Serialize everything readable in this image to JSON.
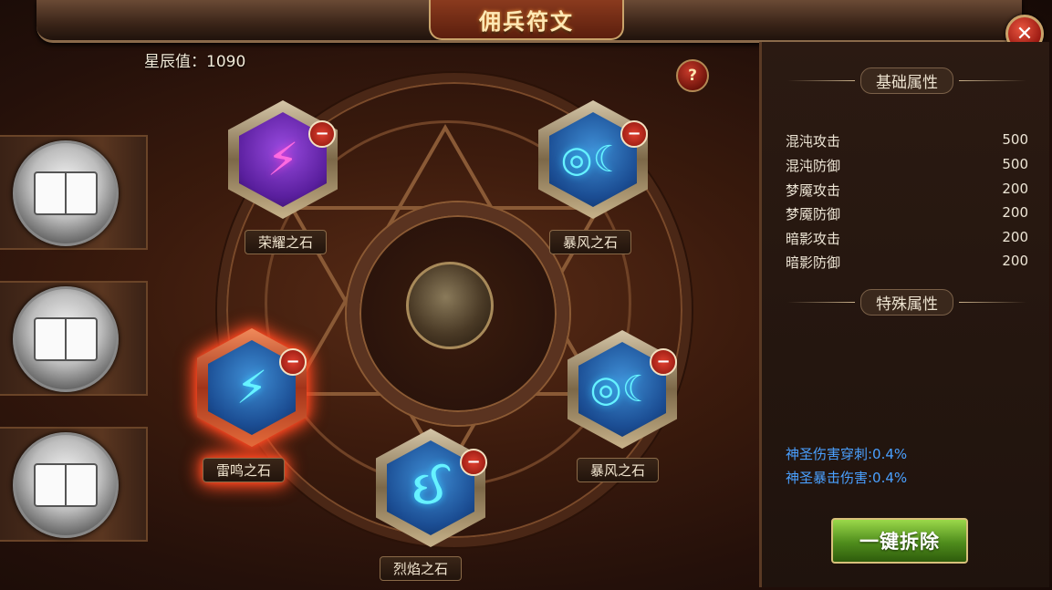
{
  "window": {
    "title": "佣兵符文"
  },
  "header": {
    "star_value_label": "星辰值：1090",
    "help_label": "?",
    "close_label": "✕"
  },
  "tabs": [
    {
      "icon": "book-icon"
    },
    {
      "icon": "book-icon"
    },
    {
      "icon": "book-icon"
    }
  ],
  "slots": {
    "glory": {
      "label": "荣耀之石",
      "glyph": "⚡",
      "gem_color": "#6a2fb3"
    },
    "storm1": {
      "label": "暴风之石",
      "glyph": "◎☾",
      "gem_color": "#1f5aa5"
    },
    "thunder": {
      "label": "雷鸣之石",
      "glyph": "⚡",
      "gem_color": "#1f5aa5"
    },
    "storm2": {
      "label": "暴风之石",
      "glyph": "◎☾",
      "gem_color": "#1f5aa5"
    },
    "flame": {
      "label": "烈焰之石",
      "glyph": "ઈ",
      "gem_color": "#1f5aa5"
    }
  },
  "remove_label": "−",
  "panel": {
    "base_header": "基础属性",
    "base_attrs": [
      {
        "name": "混沌攻击",
        "value": "500"
      },
      {
        "name": "混沌防御",
        "value": "500"
      },
      {
        "name": "梦魇攻击",
        "value": "200"
      },
      {
        "name": "梦魇防御",
        "value": "200"
      },
      {
        "name": "暗影攻击",
        "value": "200"
      },
      {
        "name": "暗影防御",
        "value": "200"
      }
    ],
    "special_header": "特殊属性",
    "special_attrs": [
      "神圣伤害穿刺:0.4%",
      "神圣暴击伤害:0.4%"
    ],
    "dismantle_all_label": "一键拆除"
  },
  "colors": {
    "accent_red": "#ff3a1a",
    "special_text": "#4aa0ff",
    "button_green": "#4f8c1c"
  }
}
